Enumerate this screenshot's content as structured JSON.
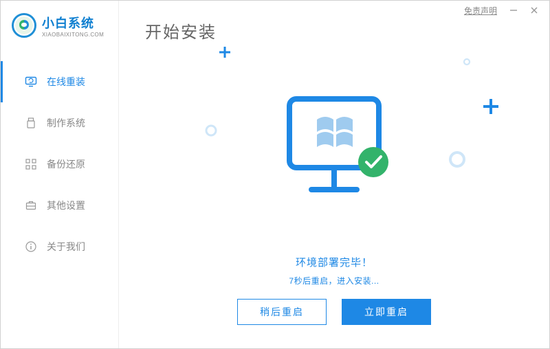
{
  "titlebar": {
    "disclaimer": "免责声明"
  },
  "logo": {
    "cn": "小白系统",
    "en": "XIAOBAIXITONG.COM"
  },
  "nav": {
    "items": [
      {
        "label": "在线重装"
      },
      {
        "label": "制作系统"
      },
      {
        "label": "备份还原"
      },
      {
        "label": "其他设置"
      },
      {
        "label": "关于我们"
      }
    ]
  },
  "main": {
    "title": "开始安装",
    "status_title": "环境部署完毕！",
    "status_sub": "7秒后重启，进入安装...",
    "btn_later": "稍后重启",
    "btn_now": "立即重启"
  }
}
